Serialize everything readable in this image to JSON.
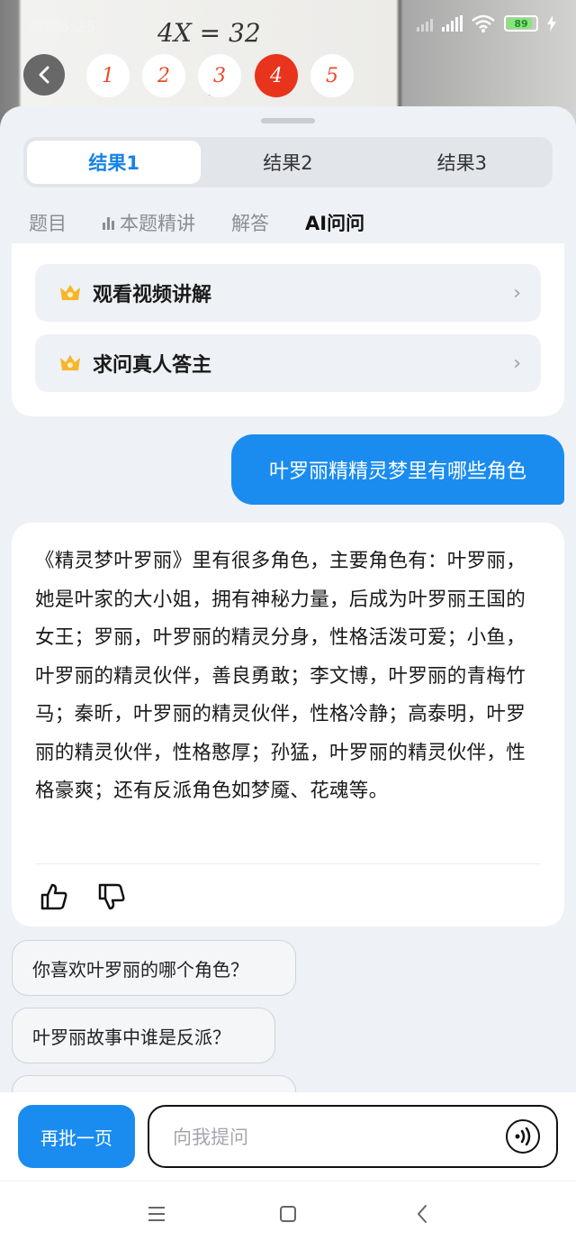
{
  "status_bar": {
    "time": "傍晚6:25",
    "battery": "89"
  },
  "pages": [
    "1",
    "2",
    "3",
    "4",
    "5"
  ],
  "active_page": "4",
  "result_tabs": [
    "结果1",
    "结果2",
    "结果3"
  ],
  "content_tabs": [
    "题目",
    "本题精讲",
    "解答",
    "AI问问"
  ],
  "options": {
    "video": "观看视频讲解",
    "ask_person": "求问真人答主"
  },
  "user_message": "叶罗丽精精灵梦里有哪些角色",
  "answer": "《精灵梦叶罗丽》里有很多角色，主要角色有：叶罗丽，她是叶家的大小姐，拥有神秘力量，后成为叶罗丽王国的女王；罗丽，叶罗丽的精灵分身，性格活泼可爱；小鱼，叶罗丽的精灵伙伴，善良勇敢；李文博，叶罗丽的青梅竹马；秦昕，叶罗丽的精灵伙伴，性格冷静；高泰明，叶罗丽的精灵伙伴，性格憨厚；孙猛，叶罗丽的精灵伙伴，性格豪爽；还有反派角色如梦魇、花魂等。",
  "suggestions": [
    "你喜欢叶罗丽的哪个角色？",
    "叶罗丽故事中谁是反派？"
  ],
  "bottom": {
    "again_label": "再批一页",
    "input_placeholder": "向我提问"
  },
  "colors": {
    "accent": "#1a8cf0",
    "active_page": "#e8341c"
  }
}
